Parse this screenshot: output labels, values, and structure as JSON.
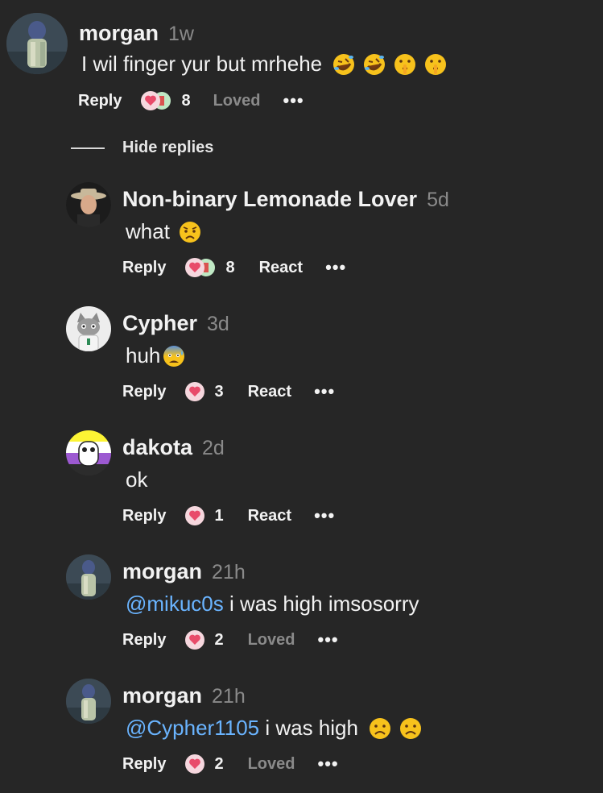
{
  "comments": [
    {
      "username": "morgan",
      "time": "1w",
      "text": "I wil finger yur but mrhehe",
      "mention": "",
      "emojis": [
        "rofl-emoji",
        "rofl-emoji",
        "shushing-face-emoji",
        "shushing-face-emoji"
      ],
      "reply_label": "Reply",
      "reaction_count": "8",
      "react_label": "Loved",
      "more_label": "•••"
    },
    {
      "username": "Non-binary Lemonade Lover",
      "time": "5d",
      "text": "what",
      "mention": "",
      "emojis": [
        "worried-face-emoji"
      ],
      "reply_label": "Reply",
      "reaction_count": "8",
      "react_label": "React",
      "more_label": "•••"
    },
    {
      "username": "Cypher",
      "time": "3d",
      "text": "huh",
      "mention": "",
      "emojis": [
        "anxious-face-with-sweat-emoji"
      ],
      "reply_label": "Reply",
      "reaction_count": "3",
      "react_label": "React",
      "more_label": "•••"
    },
    {
      "username": "dakota",
      "time": "2d",
      "text": "ok",
      "mention": "",
      "emojis": [],
      "reply_label": "Reply",
      "reaction_count": "1",
      "react_label": "React",
      "more_label": "•••"
    },
    {
      "username": "morgan",
      "time": "21h",
      "text": " i was high imsosorry",
      "mention": "@mikuc0s",
      "emojis": [],
      "reply_label": "Reply",
      "reaction_count": "2",
      "react_label": "Loved",
      "more_label": "•••"
    },
    {
      "username": "morgan",
      "time": "21h",
      "text": " i was high",
      "mention": "@Cypher1105",
      "emojis": [
        "frowning-face-emoji",
        "frowning-face-emoji"
      ],
      "reply_label": "Reply",
      "reaction_count": "2",
      "react_label": "Loved",
      "more_label": "•••"
    }
  ],
  "thread": {
    "hide_replies_label": "Hide replies"
  },
  "colors": {
    "background": "#262626",
    "mention": "#6ab4ff",
    "muted": "#8a8a8a",
    "heart": "#e84b6a"
  }
}
